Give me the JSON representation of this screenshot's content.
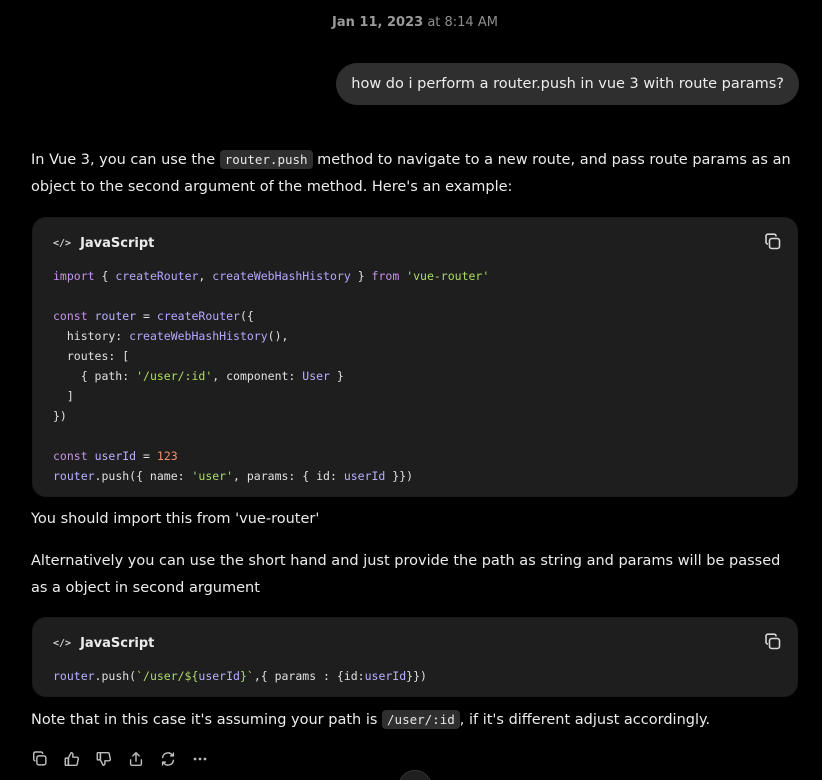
{
  "timestamp": {
    "date": "Jan 11, 2023",
    "time": "at 8:14 AM"
  },
  "user_message": "how do i perform a router.push in vue 3 with route params?",
  "response": {
    "intro_before": "In Vue 3, you can use the ",
    "intro_code": "router.push",
    "intro_after": " method to navigate to a new route, and pass route params as an object to the second argument of the method. Here's an example:",
    "code1_lang": "JavaScript",
    "code1_lines": [
      "import { createRouter, createWebHashHistory } from 'vue-router'",
      "",
      "const router = createRouter({",
      "  history: createWebHashHistory(),",
      "  routes: [",
      "    { path: '/user/:id', component: User }",
      "  ]",
      "})",
      "",
      "const userId = 123",
      "router.push({ name: 'user', params: { id: userId }})"
    ],
    "note_import": "You should import this from 'vue-router'",
    "alt_text": "Alternatively you can use the short hand and just provide the path as string and params will be passed as a object in second argument",
    "code2_lang": "JavaScript",
    "code2_line": "router.push(`/user/${userId}`,{ params : {id:userId}})",
    "final_before": "Note that in this case it's assuming your path is ",
    "final_code": "/user/:id",
    "final_after": ", if it's different adjust accordingly."
  },
  "icons": {
    "code_icon": "code-icon",
    "copy": "copy-icon",
    "thumbs_up": "thumbs-up-icon",
    "thumbs_down": "thumbs-down-icon",
    "share": "share-icon",
    "regenerate": "regenerate-icon",
    "more": "more-icon"
  },
  "colors": {
    "background": "#000000",
    "bubble": "#2f2f2f",
    "code_bg": "#1e1e1e",
    "keyword": "#c792ea",
    "string": "#addb67",
    "number": "#f78c6c"
  }
}
